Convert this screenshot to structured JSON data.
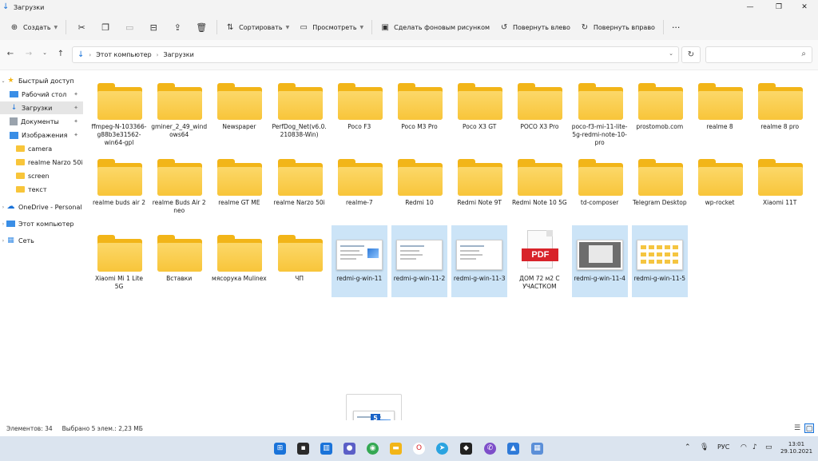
{
  "window": {
    "title": "Загрузки",
    "minimize": "—",
    "maximize": "❐",
    "close": "✕"
  },
  "commandbar": {
    "create": "Создать",
    "sort": "Сортировать",
    "view": "Просмотреть",
    "set_wallpaper": "Сделать фоновым рисунком",
    "rotate_left": "Повернуть влево",
    "rotate_right": "Повернуть вправо",
    "more": "···"
  },
  "address": {
    "segments": [
      "Этот компьютер",
      "Загрузки"
    ],
    "search_placeholder": ""
  },
  "sidebar": {
    "items": [
      {
        "label": "Быстрый доступ"
      },
      {
        "label": "Рабочий стол"
      },
      {
        "label": "Загрузки"
      },
      {
        "label": "Документы"
      },
      {
        "label": "Изображения"
      },
      {
        "label": "camera"
      },
      {
        "label": "realme Narzo 50i"
      },
      {
        "label": "screen"
      },
      {
        "label": "текст"
      },
      {
        "label": "OneDrive - Personal"
      },
      {
        "label": "Этот компьютер"
      },
      {
        "label": "Сеть"
      }
    ]
  },
  "files": [
    {
      "name": "ffmpeg-N-103366-g88b3e31562-win64-gpl",
      "kind": "folder"
    },
    {
      "name": "gminer_2_49_windows64",
      "kind": "folder"
    },
    {
      "name": "Newspaper",
      "kind": "folder"
    },
    {
      "name": "PerfDog_Net(v6.0.210838-Win)",
      "kind": "folder"
    },
    {
      "name": "Poco F3",
      "kind": "folder"
    },
    {
      "name": "Poco M3 Pro",
      "kind": "folder"
    },
    {
      "name": "Poco X3 GT",
      "kind": "folder"
    },
    {
      "name": "POCO X3 Pro",
      "kind": "folder"
    },
    {
      "name": "poco-f3-mi-11-lite-5g-redmi-note-10-pro",
      "kind": "folder"
    },
    {
      "name": "prostomob.com",
      "kind": "folder"
    },
    {
      "name": "realme 8",
      "kind": "folder"
    },
    {
      "name": "realme 8 pro",
      "kind": "folder"
    },
    {
      "name": "realme buds air 2",
      "kind": "folder"
    },
    {
      "name": "realme Buds Air 2 neo",
      "kind": "folder"
    },
    {
      "name": "realme GT ME",
      "kind": "folder"
    },
    {
      "name": "realme Narzo 50i",
      "kind": "folder"
    },
    {
      "name": "realme-7",
      "kind": "folder"
    },
    {
      "name": "Redmi 10",
      "kind": "folder"
    },
    {
      "name": "Redmi Note 9T",
      "kind": "folder"
    },
    {
      "name": "Redmi Note 10 5G",
      "kind": "folder"
    },
    {
      "name": "td-composer",
      "kind": "folder"
    },
    {
      "name": "Telegram Desktop",
      "kind": "folder"
    },
    {
      "name": "wp-rocket",
      "kind": "folder"
    },
    {
      "name": "Xiaomi 11T",
      "kind": "folder"
    },
    {
      "name": "Xiaomi Mi 1 Lite 5G",
      "kind": "folder"
    },
    {
      "name": "Вставки",
      "kind": "folder"
    },
    {
      "name": "мясорука Mulinex",
      "kind": "folder"
    },
    {
      "name": "ЧП",
      "kind": "folder"
    },
    {
      "name": "redmi-g-win-11",
      "kind": "image-a",
      "selected": true
    },
    {
      "name": "redmi-g-win-11-2",
      "kind": "image-b",
      "selected": true
    },
    {
      "name": "redmi-g-win-11-3",
      "kind": "image-c",
      "selected": true
    },
    {
      "name": "ДОМ 72 м2 С УЧАСТКОМ",
      "kind": "pdf",
      "badge": "PDF"
    },
    {
      "name": "redmi-g-win-11-4",
      "kind": "image-d",
      "selected": true
    },
    {
      "name": "redmi-g-win-11-5",
      "kind": "image-e",
      "selected": true
    }
  ],
  "drag": {
    "count": "5"
  },
  "status": {
    "items": "Элементов: 34",
    "selected": "Выбрано 5 элем.: 2,23 МБ"
  },
  "taskbar": {
    "lang": "РУС",
    "time": "13:01",
    "date": "29.10.2021"
  },
  "colors": {
    "accent": "#1a73d9",
    "selection": "#cce4f7",
    "folder": "#f8c53a",
    "pdf_badge": "#d8232a",
    "taskbar": "#dbe4ef"
  }
}
